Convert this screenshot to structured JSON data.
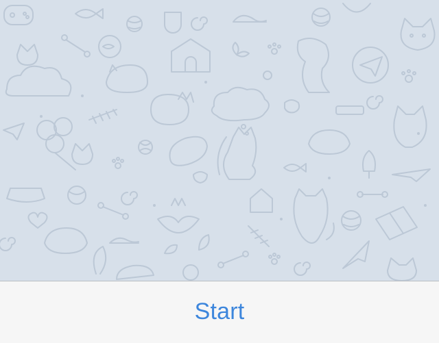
{
  "chat": {
    "background_color": "#d7e0ea",
    "doodle_color": "#bcc8d6",
    "doodles": [
      "gamepad-icon",
      "fish-icon",
      "cat-face-icon",
      "ball-icon",
      "bone-icon",
      "mouse-toy-icon",
      "doghouse-icon",
      "dog-icon",
      "paper-plane-icon",
      "sleeping-cat-icon",
      "fish-skeleton-icon",
      "cat-bed-icon",
      "thought-cloud-icon",
      "collar-icon",
      "yarn-ball-icon",
      "paw-icon",
      "balloon-cat-icon",
      "fox-icon",
      "food-bowl-icon",
      "spiral-icon",
      "heart-icon",
      "tulip-icon",
      "gift-box-icon"
    ]
  },
  "bottom_bar": {
    "start_label": "Start",
    "accent_color": "#3d86dc"
  }
}
